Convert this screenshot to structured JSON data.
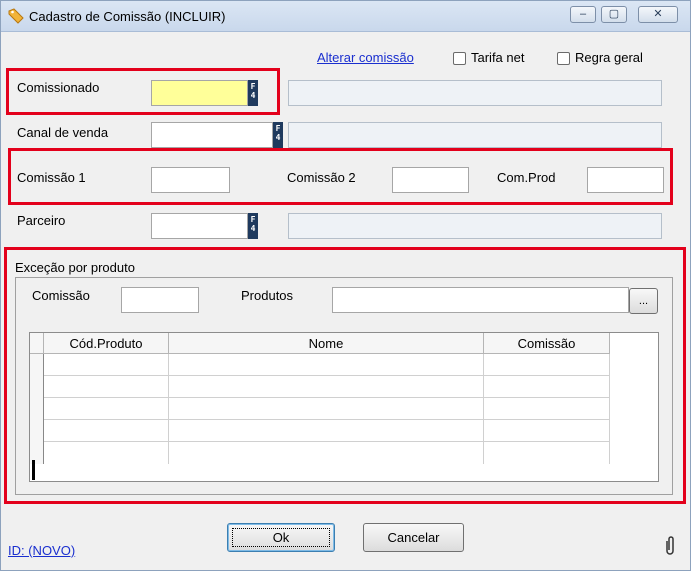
{
  "window": {
    "title": "Cadastro de Comissão (INCLUIR)",
    "icon": "tag-icon",
    "controls": {
      "minimize": "‒",
      "maximize": "▢",
      "close": "✕"
    }
  },
  "header": {
    "alterar_link": "Alterar comissão",
    "tarifa_net": {
      "label": "Tarifa net",
      "checked": false
    },
    "regra_geral": {
      "label": "Regra geral",
      "checked": false
    }
  },
  "fields": {
    "comissionado": {
      "label": "Comissionado",
      "value": "",
      "lookup_key": "F4",
      "description": ""
    },
    "canal_venda": {
      "label": "Canal de venda",
      "value": "",
      "lookup_key": "F4",
      "description": ""
    },
    "comissao1": {
      "label": "Comissão 1",
      "value": ""
    },
    "comissao2": {
      "label": "Comissão 2",
      "value": ""
    },
    "com_prod": {
      "label": "Com.Prod",
      "value": ""
    },
    "parceiro": {
      "label": "Parceiro",
      "value": "",
      "lookup_key": "F4",
      "description": ""
    }
  },
  "excecao": {
    "title": "Exceção por produto",
    "comissao_label": "Comissão",
    "comissao_value": "",
    "produtos_label": "Produtos",
    "produtos_value": "",
    "browse_button": "...",
    "table": {
      "columns": [
        "Cód.Produto",
        "Nome",
        "Comissão"
      ],
      "rows": [
        [
          "",
          "",
          ""
        ],
        [
          "",
          "",
          ""
        ],
        [
          "",
          "",
          ""
        ],
        [
          "",
          "",
          ""
        ],
        [
          "",
          "",
          ""
        ]
      ]
    }
  },
  "footer": {
    "id_link": "ID: (NOVO)",
    "ok_button": "Ok",
    "cancel_button": "Cancelar",
    "attach_icon": "paperclip-icon"
  },
  "colors": {
    "highlight_box": "#e3001b",
    "required_field": "#ffff99",
    "link": "#1a2fcf"
  }
}
